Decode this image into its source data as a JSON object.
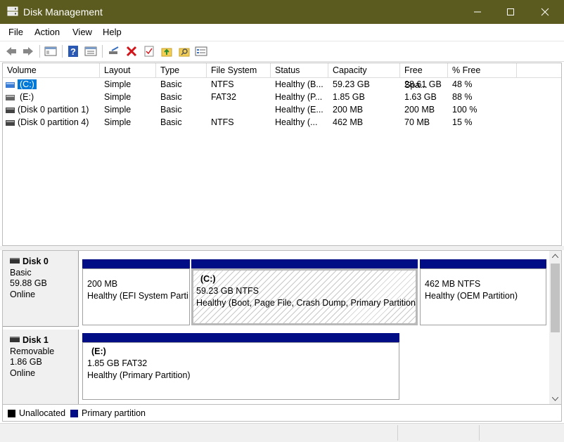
{
  "window": {
    "title": "Disk Management"
  },
  "menu": [
    "File",
    "Action",
    "View",
    "Help"
  ],
  "toolbar_icons": [
    "back-icon",
    "forward-icon",
    "console-tree-icon",
    "help-icon",
    "properties-icon",
    "connect-icon",
    "delete-icon",
    "checklist-icon",
    "folder-up-icon",
    "folder-search-icon",
    "list-icon"
  ],
  "columns": [
    "Volume",
    "Layout",
    "Type",
    "File System",
    "Status",
    "Capacity",
    "Free Spa...",
    "% Free"
  ],
  "volumes": [
    {
      "name": "(C:)",
      "layout": "Simple",
      "type": "Basic",
      "fs": "NTFS",
      "status": "Healthy (B...",
      "capacity": "59.23 GB",
      "free": "28.61 GB",
      "pct": "48 %"
    },
    {
      "name": "(E:)",
      "layout": "Simple",
      "type": "Basic",
      "fs": "FAT32",
      "status": "Healthy (P...",
      "capacity": "1.85 GB",
      "free": "1.63 GB",
      "pct": "88 %"
    },
    {
      "name": "(Disk 0 partition 1)",
      "layout": "Simple",
      "type": "Basic",
      "fs": "",
      "status": "Healthy (E...",
      "capacity": "200 MB",
      "free": "200 MB",
      "pct": "100 %"
    },
    {
      "name": "(Disk 0 partition 4)",
      "layout": "Simple",
      "type": "Basic",
      "fs": "NTFS",
      "status": "Healthy (...",
      "capacity": "462 MB",
      "free": "70 MB",
      "pct": "15 %"
    }
  ],
  "disks": [
    {
      "name": "Disk 0",
      "type": "Basic",
      "size": "59.88 GB",
      "state": "Online",
      "partitions": [
        {
          "label": "",
          "line1": "200 MB",
          "line2": "Healthy (EFI System Parti"
        },
        {
          "label": "(C:)",
          "line1": "59.23 GB NTFS",
          "line2": "Healthy (Boot, Page File, Crash Dump, Primary Partition"
        },
        {
          "label": "",
          "line1": "462 MB NTFS",
          "line2": "Healthy (OEM Partition)"
        }
      ]
    },
    {
      "name": "Disk 1",
      "type": "Removable",
      "size": "1.86 GB",
      "state": "Online",
      "partitions": [
        {
          "label": "(E:)",
          "line1": "1.85 GB FAT32",
          "line2": "Healthy (Primary Partition)"
        }
      ]
    }
  ],
  "legend": [
    {
      "label": "Unallocated",
      "color": "#000000"
    },
    {
      "label": "Primary partition",
      "color": "#000d84"
    }
  ]
}
